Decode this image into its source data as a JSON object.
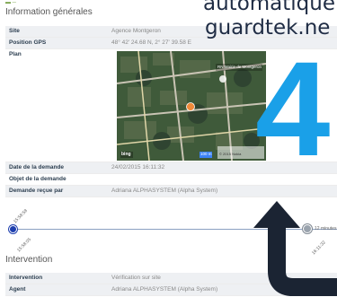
{
  "header": {
    "mark": "▬ ─"
  },
  "info": {
    "title": "Information générales",
    "rows": [
      {
        "label": "Site",
        "value": "Agence Montgeron"
      },
      {
        "label": "Position GPS",
        "value": "48° 42' 24.68 N, 2° 27' 39.58 E"
      },
      {
        "label": "Plan",
        "value": ""
      },
      {
        "label": "Date de la demande",
        "value": "24/02/2015 16:11:32"
      },
      {
        "label": "Objet de la demande",
        "value": ""
      },
      {
        "label": "Demande reçue par",
        "value": "Adriana ALPHASYSTEM (Alpha System)"
      }
    ]
  },
  "map": {
    "place_label": "RN Mairie de Montgeron",
    "scale_label": "100 m",
    "copyright": "© 2015 Nokia",
    "bing": "bing"
  },
  "timeline": {
    "start_time_top": "15:58:58",
    "start_time_bottom": "15:58:05",
    "end_time": "16:11:32",
    "duration": "12 minutes"
  },
  "intervention": {
    "title": "Intervention",
    "rows": [
      {
        "label": "Intervention",
        "value": "Vérification sur site"
      },
      {
        "label": "Agent",
        "value": "Adriana ALPHASYSTEM (Alpha System)"
      }
    ]
  },
  "overlay": {
    "line1": "automatique",
    "line2": "guardtek.ne",
    "big_number": "4",
    "accent_color": "#1aa0e8",
    "arrow_color": "#1b2433"
  }
}
